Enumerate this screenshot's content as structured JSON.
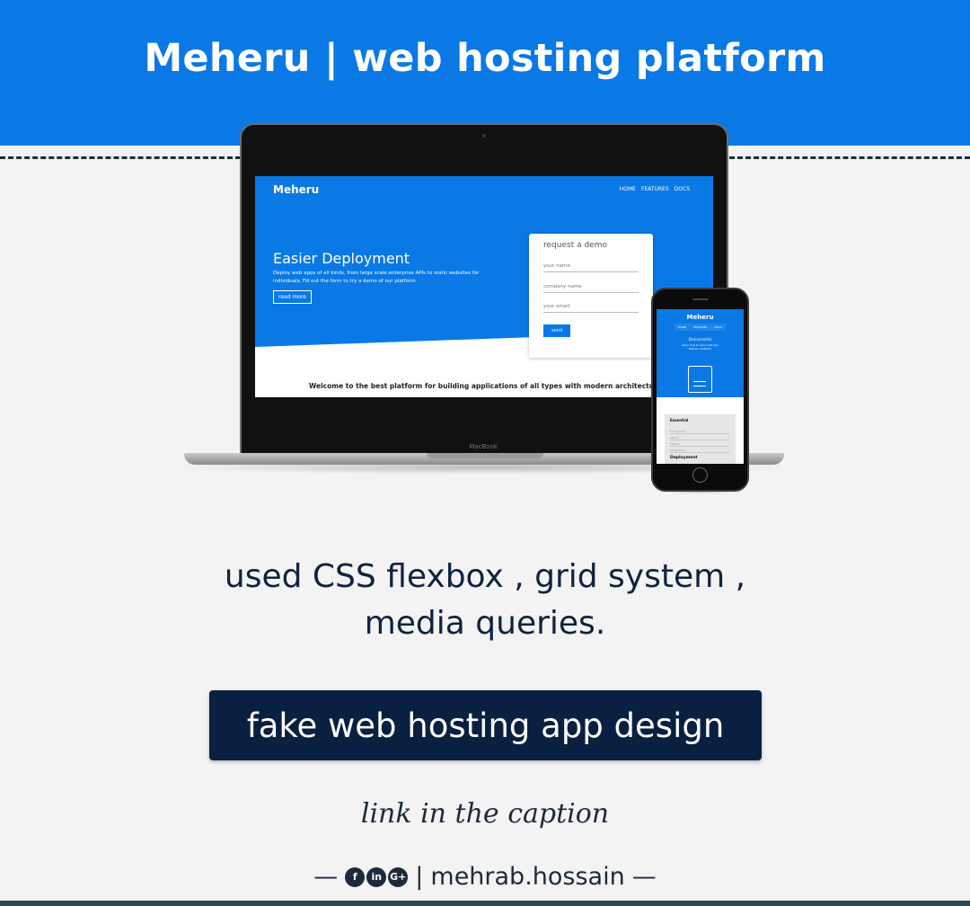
{
  "header": {
    "title": "Meheru | web hosting platform"
  },
  "colors": {
    "primary_blue": "#0a79e6",
    "dark_navy": "#0a2040",
    "text_dark": "#1e2a3a",
    "background": "#f3f3f3"
  },
  "mockup": {
    "brand": "Meheru",
    "nav": [
      "HOME",
      "FEATURES",
      "DOCS"
    ],
    "hero_heading": "Easier Deployment",
    "hero_text": "Deploy web apps of all kinds, from large scale enterprise APIs to static websites for individuals. Fill out the form to try a demo of our platform",
    "hero_button": "read more",
    "form": {
      "title": "request a demo",
      "fields": [
        "your name",
        "company name",
        "your email"
      ],
      "submit": "send"
    },
    "welcome": "Welcome to the best platform for building applications of all types with modern architecture and scaling",
    "laptop_label": "MacBook",
    "phone": {
      "brand": "Meheru",
      "nav": [
        "HOME",
        "FEATURES",
        "DOCS"
      ],
      "doc_title": "Documents",
      "doc_sub": "learn how to work with the Meheru platform",
      "section_heading": "Essential",
      "items": [
        "Introduction",
        "About",
        "Meheru",
        "Installation"
      ],
      "section2": "Deployment"
    }
  },
  "subtitle": {
    "line1": "used CSS flexbox , grid system ,",
    "line2": "media queries."
  },
  "cta": {
    "label": "fake web hosting app design"
  },
  "caption": "link in the caption",
  "footer": {
    "dash_left": "—",
    "icons": [
      "facebook-icon",
      "linkedin-icon",
      "google-plus-icon"
    ],
    "icon_glyphs": [
      "f",
      "in",
      "G+"
    ],
    "separator": "|",
    "handle": "mehrab.hossain",
    "dash_right": "—"
  }
}
